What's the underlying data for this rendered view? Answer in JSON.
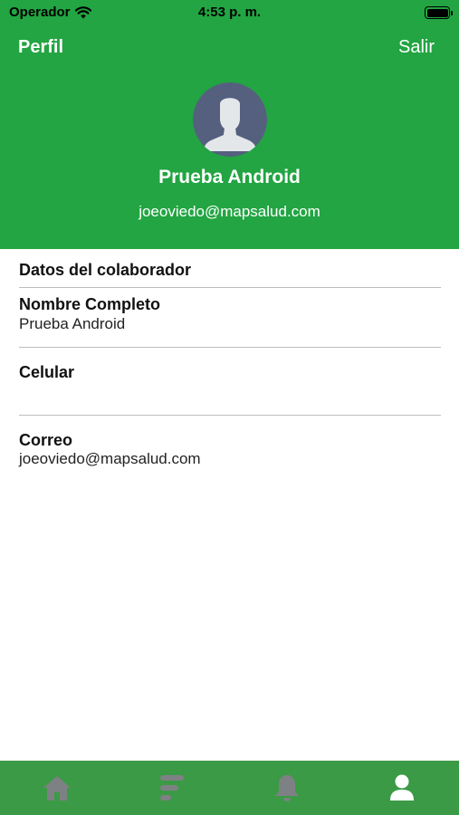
{
  "status_bar": {
    "carrier": "Operador",
    "time": "4:53 p. m."
  },
  "header": {
    "title": "Perfil",
    "logout_label": "Salir",
    "background_color": "#22a542"
  },
  "profile": {
    "name": "Prueba Android",
    "email": "joeoviedo@mapsalud.com",
    "avatar_icon": "person-silhouette-icon"
  },
  "details": {
    "section_title": "Datos del colaborador",
    "fields": [
      {
        "label": "Nombre Completo",
        "value": "Prueba Android"
      },
      {
        "label": "Celular",
        "value": ""
      },
      {
        "label": "Correo",
        "value": "joeoviedo@mapsalud.com"
      }
    ]
  },
  "tab_bar": {
    "background_color": "#3b9a45",
    "tabs": [
      {
        "icon": "home-icon",
        "active": false
      },
      {
        "icon": "list-icon",
        "active": false
      },
      {
        "icon": "bell-icon",
        "active": false
      },
      {
        "icon": "profile-icon",
        "active": true
      }
    ]
  }
}
